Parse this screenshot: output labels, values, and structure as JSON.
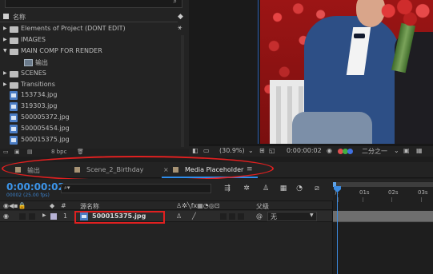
{
  "project": {
    "column_name": "名称",
    "items": [
      {
        "type": "folder",
        "expanded": false,
        "indent": 0,
        "name": "Elements of Project (DONT EDIT)"
      },
      {
        "type": "folder",
        "expanded": false,
        "indent": 0,
        "name": "IMAGES"
      },
      {
        "type": "folder",
        "expanded": true,
        "indent": 0,
        "name": "MAIN COMP FOR RENDER"
      },
      {
        "type": "comp",
        "expanded": false,
        "indent": 1,
        "name": "输出"
      },
      {
        "type": "folder",
        "expanded": false,
        "indent": 0,
        "name": "SCENES"
      },
      {
        "type": "folder",
        "expanded": false,
        "indent": 0,
        "name": "Transitions"
      },
      {
        "type": "file",
        "indent": 0,
        "name": "153734.jpg"
      },
      {
        "type": "file",
        "indent": 0,
        "name": "319303.jpg"
      },
      {
        "type": "file",
        "indent": 0,
        "name": "500005372.jpg"
      },
      {
        "type": "file",
        "indent": 0,
        "name": "500005454.jpg"
      },
      {
        "type": "file",
        "indent": 0,
        "name": "500015375.jpg"
      }
    ],
    "bpc": "8 bpc"
  },
  "viewer": {
    "zoom": "(30.9%)",
    "timecode": "0:00:00:02",
    "resolution": "二分之一"
  },
  "tabs": [
    {
      "label": "输出",
      "active": false
    },
    {
      "label": "Scene_2_Birthday",
      "active": false
    },
    {
      "label": "Media Placeholder",
      "active": true,
      "close": "×",
      "menu": "≡"
    }
  ],
  "timeline": {
    "timecode": "0:00:00:02",
    "fps": "00002 (25.00 fps)",
    "search_placeholder": "",
    "columns": {
      "number": "#",
      "source_name": "源名称",
      "parent": "父级"
    },
    "layer": {
      "index": "1",
      "name": "500015375.jpg",
      "parent": "无"
    },
    "ruler_ticks": [
      "01s",
      "02s",
      "03s"
    ]
  },
  "colors": {
    "accent_blue": "#3c95ea",
    "annotation_red": "#e02020",
    "panel_bg": "#232323"
  }
}
